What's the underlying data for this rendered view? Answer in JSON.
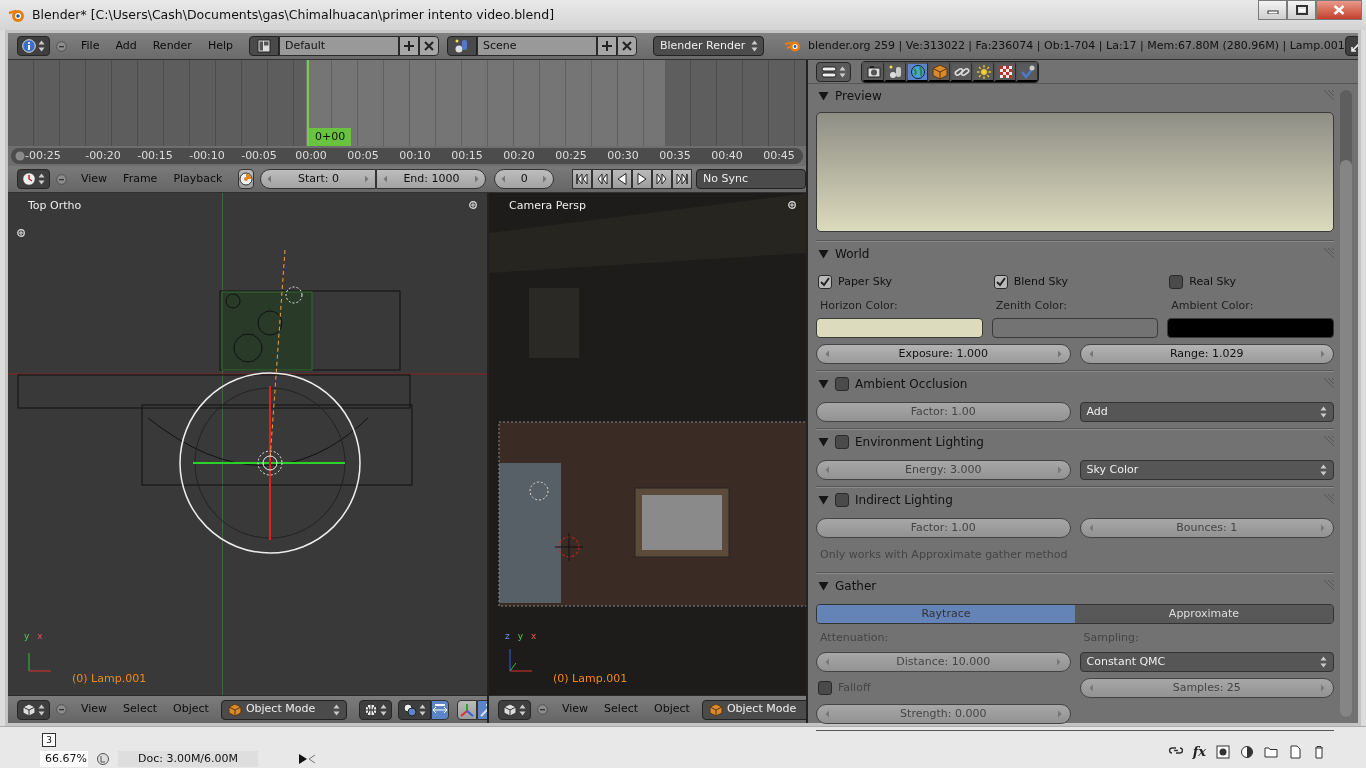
{
  "window": {
    "title": "Blender* [C:\\Users\\Cash\\Documents\\gas\\Chimalhuacan\\primer intento video.blend]"
  },
  "info_header": {
    "menus": [
      "File",
      "Add",
      "Render",
      "Help"
    ],
    "screen_layout": "Default",
    "scene": "Scene",
    "render_engine": "Blender Render",
    "stats": "blender.org 259 | Ve:313022 | Fa:236074 | Ob:1-704 | La:17 | Mem:67.80M (280.96M) | Lamp.001"
  },
  "timeline": {
    "cursor_label": "0+00",
    "ticks": [
      "-00:25",
      "-00:20",
      "-00:15",
      "-00:10",
      "-00:05",
      "00:00",
      "00:05",
      "00:10",
      "00:15",
      "00:20",
      "00:25",
      "00:30",
      "00:35",
      "00:40",
      "00:45"
    ],
    "menus": [
      "View",
      "Frame",
      "Playback"
    ],
    "start": "Start: 0",
    "end": "End: 1000",
    "current_frame": "0",
    "sync": "No Sync"
  },
  "viewports": [
    {
      "kind": "top_ortho",
      "label": "Top Ortho",
      "object_label": "(0) Lamp.001",
      "axes": [
        "y",
        "x"
      ],
      "menus": [
        "View",
        "Select",
        "Object"
      ],
      "mode": "Object Mode"
    },
    {
      "kind": "camera",
      "label": "Camera Persp",
      "object_label": "(0) Lamp.001",
      "axes": [
        "z",
        "y",
        "x"
      ],
      "menus": [
        "View",
        "Select",
        "Object"
      ],
      "mode": "Object Mode"
    }
  ],
  "properties": {
    "tabs": [
      {
        "kind": "render",
        "selected": false
      },
      {
        "kind": "scene",
        "selected": false
      },
      {
        "kind": "world",
        "selected": true
      },
      {
        "kind": "object",
        "selected": false
      },
      {
        "kind": "constraints",
        "selected": false
      },
      {
        "kind": "lamp",
        "selected": false
      },
      {
        "kind": "texture",
        "selected": false
      },
      {
        "kind": "physics",
        "selected": false
      }
    ],
    "panels": [
      {
        "kind": "preview",
        "title": "Preview",
        "expanded": true
      },
      {
        "kind": "world",
        "title": "World",
        "expanded": true,
        "inactive": false,
        "sky_options": [
          {
            "label": "Paper Sky",
            "checked": true
          },
          {
            "label": "Blend Sky",
            "checked": true
          },
          {
            "label": "Real Sky",
            "checked": false
          }
        ],
        "colors": [
          {
            "label": "Horizon Color:",
            "color": "#dddbbd"
          },
          {
            "label": "Zenith Color:",
            "color": "#737373"
          },
          {
            "label": "Ambient Color:",
            "color": "#000000"
          }
        ],
        "values": [
          "Exposure: 1.000",
          "Range: 1.029"
        ]
      },
      {
        "kind": "settings",
        "title": "Ambient Occlusion",
        "expanded": true,
        "enabled": false,
        "inactive": true,
        "rows": [
          {
            "cells": [
              {
                "kind": "slider",
                "text": "Factor: 1.00"
              },
              {
                "kind": "dropdown",
                "text": "Add"
              }
            ]
          }
        ]
      },
      {
        "kind": "settings",
        "title": "Environment Lighting",
        "expanded": true,
        "enabled": false,
        "inactive": true,
        "rows": [
          {
            "cells": [
              {
                "kind": "number",
                "text": "Energy: 3.000"
              },
              {
                "kind": "dropdown",
                "text": "Sky Color"
              }
            ]
          }
        ]
      },
      {
        "kind": "settings",
        "title": "Indirect Lighting",
        "expanded": true,
        "enabled": false,
        "inactive": true,
        "rows": [
          {
            "cells": [
              {
                "kind": "slider",
                "text": "Factor: 1.00"
              },
              {
                "kind": "number",
                "text": "Bounces: 1"
              }
            ]
          },
          {
            "cells": [
              {
                "kind": "note",
                "text": "Only works with Approximate gather method"
              }
            ]
          }
        ]
      },
      {
        "kind": "settings",
        "title": "Gather",
        "expanded": true,
        "inactive": true,
        "rows": [
          {
            "cells": [
              {
                "kind": "toggle",
                "options": [
                  {
                    "label": "Raytrace",
                    "selected": true
                  },
                  {
                    "label": "Approximate",
                    "selected": false
                  }
                ]
              }
            ]
          },
          {
            "cells": [
              {
                "kind": "caption",
                "text": "Attenuation:"
              },
              {
                "kind": "caption",
                "text": "Sampling:"
              }
            ]
          },
          {
            "cells": [
              {
                "kind": "number",
                "text": "Distance: 10.000"
              },
              {
                "kind": "dropdown",
                "text": "Constant QMC"
              }
            ]
          },
          {
            "cells": [
              {
                "kind": "checkbox",
                "label": "Falloff",
                "checked": false
              },
              {
                "kind": "number",
                "text": "Samples: 25"
              }
            ]
          },
          {
            "cells": [
              {
                "kind": "number",
                "text": "Strength: 0.000"
              },
              {
                "kind": "empty"
              }
            ]
          }
        ]
      }
    ]
  },
  "status_strip": {
    "page": "3",
    "zoom": "66.67%",
    "doc": "Doc: 3.00M/6.00M",
    "layer_tools": [
      {
        "kind": "link"
      },
      {
        "kind": "text",
        "label": "fx"
      },
      {
        "kind": "mask"
      },
      {
        "kind": "adjust"
      },
      {
        "kind": "folder"
      },
      {
        "kind": "new"
      },
      {
        "kind": "trash"
      }
    ]
  }
}
